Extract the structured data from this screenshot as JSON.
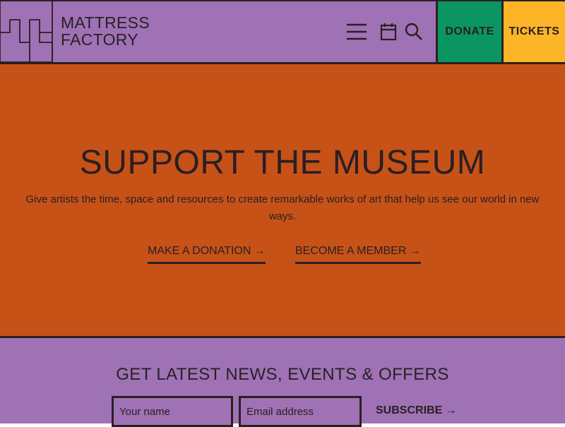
{
  "header": {
    "logo_line1": "MATTRESS",
    "logo_line2": "FACTORY",
    "icons": [
      "menu-icon",
      "calendar-icon",
      "search-icon"
    ],
    "donate_label": "DONATE",
    "tickets_label": "TICKETS"
  },
  "hero": {
    "title": "SUPPORT THE MUSEUM",
    "text": "Give artists the time, space and resources to create remarkable works of art that help us see our world in new ways.",
    "donation_link": "MAKE A DONATION →",
    "member_link": "BECOME A MEMBER →"
  },
  "newsletter": {
    "title": "GET LATEST NEWS, EVENTS & OFFERS",
    "name_placeholder": "Your name",
    "email_placeholder": "Email address",
    "name_value": "",
    "email_value": "",
    "subscribe_label": "SUBSCRIBE →"
  },
  "colors": {
    "purple": "#9e72b4",
    "orange": "#c65218",
    "green": "#0a9563",
    "yellow": "#fbb526",
    "ink": "#2a1f22"
  }
}
